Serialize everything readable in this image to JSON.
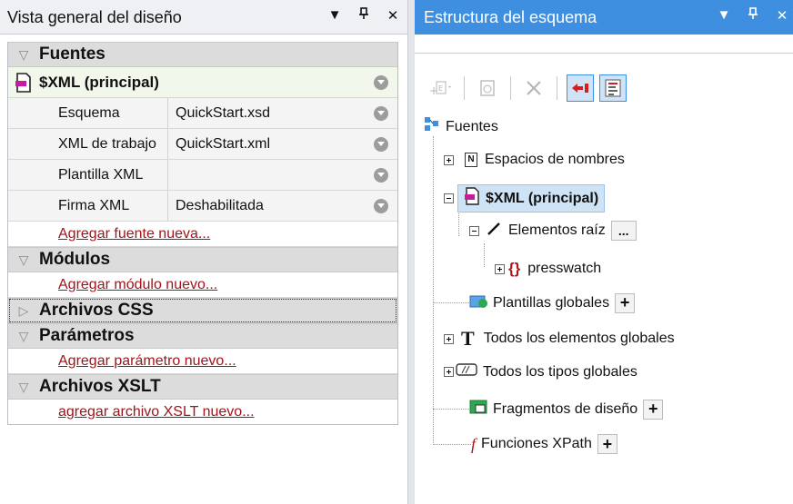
{
  "left_panel": {
    "title": "Vista general del diseño",
    "sources_group": "Fuentes",
    "main_source": "$XML (principal)",
    "properties": [
      {
        "key": "Esquema",
        "value": "QuickStart.xsd"
      },
      {
        "key": "XML de trabajo",
        "value": "QuickStart.xml"
      },
      {
        "key": "Plantilla XML",
        "value": ""
      },
      {
        "key": "Firma XML",
        "value": "Deshabilitada"
      }
    ],
    "add_source": "Agregar fuente nueva...",
    "modules_group": "Módulos",
    "add_module": "Agregar módulo nuevo...",
    "css_group": "Archivos CSS",
    "params_group": "Parámetros",
    "add_param": "Agregar parámetro nuevo...",
    "xslt_group": "Archivos XSLT",
    "add_xslt": "agregar archivo XSLT nuevo..."
  },
  "right_panel": {
    "title": "Estructura del esquema",
    "tree": {
      "root": "Fuentes",
      "namespaces": "Espacios de nombres",
      "main": "$XML (principal)",
      "root_elements": "Elementos raíz",
      "more": "...",
      "presswatch": "presswatch",
      "global_templates": "Plantillas globales",
      "all_global_elements": "Todos los elementos globales",
      "all_global_types": "Todos los tipos globales",
      "design_fragments": "Fragmentos de diseño",
      "xpath_functions": "Funciones XPath",
      "add": "+"
    }
  },
  "window_controls": {
    "menu": "▼",
    "pin": "ᵽ",
    "close": "✕"
  },
  "colors": {
    "accent": "#3f8fe0",
    "link": "#a0151a",
    "selection": "#cfe3f7"
  }
}
